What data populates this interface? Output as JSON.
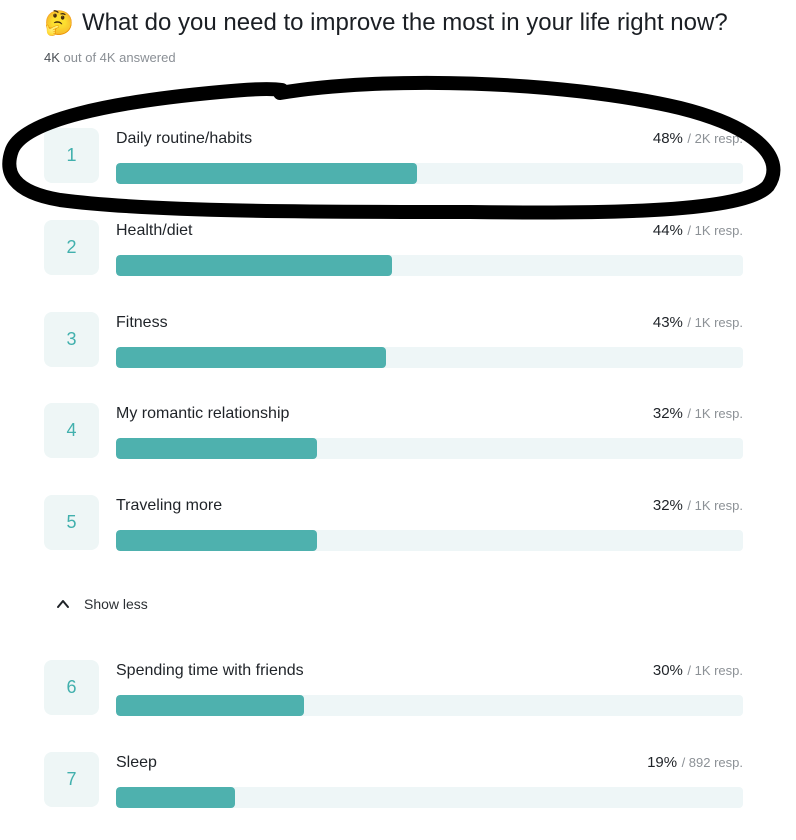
{
  "poll": {
    "emoji": "🤔",
    "question": "What do you need to improve the most in your life right now?",
    "answered_count": "4K",
    "answered_text": "out of 4K answered"
  },
  "options": [
    {
      "rank": "1",
      "label": "Daily routine/habits",
      "percent": "48%",
      "responses": "/ 2K resp.",
      "value": 48
    },
    {
      "rank": "2",
      "label": "Health/diet",
      "percent": "44%",
      "responses": "/ 1K resp.",
      "value": 44
    },
    {
      "rank": "3",
      "label": "Fitness",
      "percent": "43%",
      "responses": "/ 1K resp.",
      "value": 43
    },
    {
      "rank": "4",
      "label": "My romantic relationship",
      "percent": "32%",
      "responses": "/ 1K resp.",
      "value": 32
    },
    {
      "rank": "5",
      "label": "Traveling more",
      "percent": "32%",
      "responses": "/ 1K resp.",
      "value": 32
    },
    {
      "rank": "6",
      "label": "Spending time with friends",
      "percent": "30%",
      "responses": "/ 1K resp.",
      "value": 30
    },
    {
      "rank": "7",
      "label": "Sleep",
      "percent": "19%",
      "responses": "/ 892 resp.",
      "value": 19
    }
  ],
  "show_less": {
    "label": "Show less",
    "icon": "chevron-up-icon"
  },
  "colors": {
    "bar_fill": "#4eb1ae",
    "bar_track": "#eef6f7",
    "rank_text": "#41b0ad",
    "rank_bg": "#eef6f6",
    "annotation": "#000000"
  },
  "annotation": {
    "type": "hand-drawn-circle",
    "target": "option-1"
  }
}
